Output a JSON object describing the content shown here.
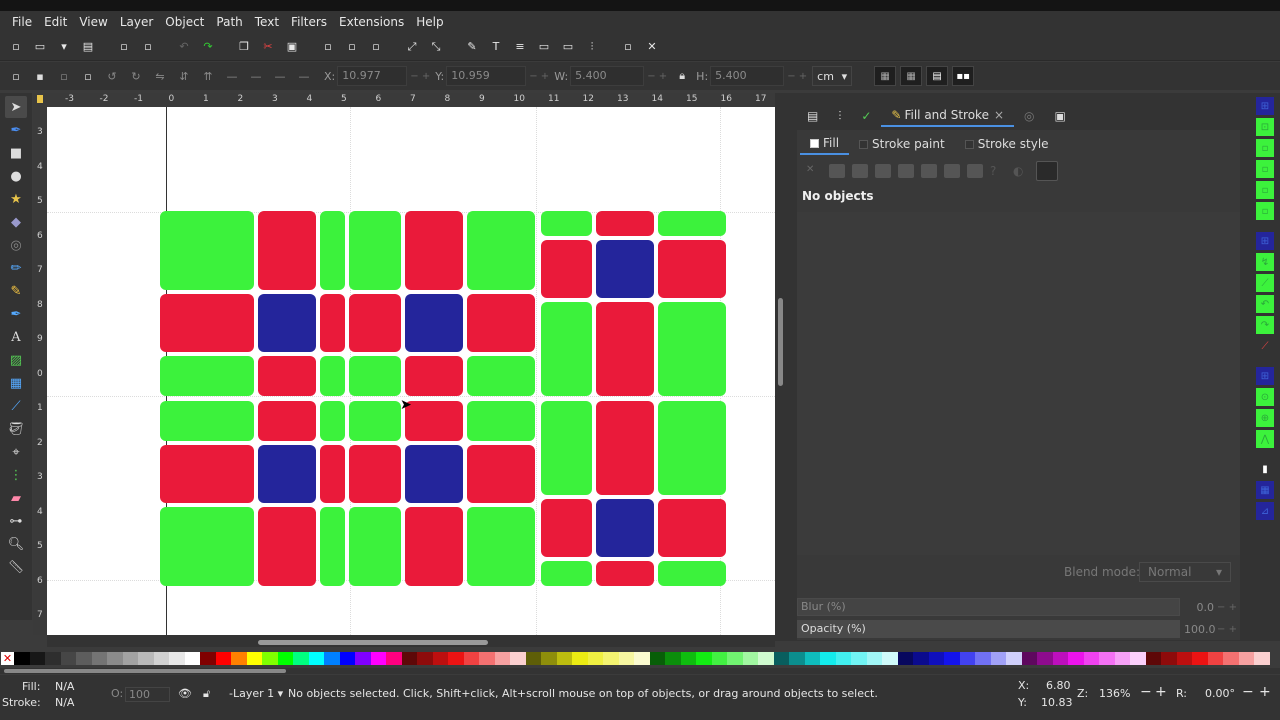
{
  "menu": [
    "File",
    "Edit",
    "View",
    "Layer",
    "Object",
    "Path",
    "Text",
    "Filters",
    "Extensions",
    "Help"
  ],
  "toolcontrols": {
    "x_label": "X:",
    "x_value": "10.977",
    "y_label": "Y:",
    "y_value": "10.959",
    "w_label": "W:",
    "w_value": "5.400",
    "h_label": "H:",
    "h_value": "5.400",
    "unit": "cm"
  },
  "ruler_top_labels": [
    "-3",
    "-2",
    "-1",
    "0",
    "1",
    "2",
    "3",
    "4",
    "5",
    "6",
    "7",
    "8",
    "9",
    "10",
    "11",
    "12",
    "13",
    "14",
    "15",
    "16",
    "17"
  ],
  "ruler_left_labels": [
    "3",
    "4",
    "5",
    "6",
    "7",
    "8",
    "9",
    "0",
    "1",
    "2",
    "3",
    "4",
    "5",
    "6",
    "7"
  ],
  "dock": {
    "tabs": [
      "",
      "",
      "",
      "Fill and Stroke",
      "",
      ""
    ],
    "active_tab": "Fill and Stroke",
    "close_glyph": "×",
    "fill_tabs": [
      "Fill",
      "Stroke paint",
      "Stroke style"
    ],
    "no_objects": "No objects",
    "blend_mode_label": "Blend mode:",
    "blend_mode_value": "Normal",
    "blur_label": "Blur (%)",
    "blur_value": "0.0",
    "opacity_label": "Opacity (%)",
    "opacity_value": "100.0"
  },
  "status": {
    "fill_label": "Fill:",
    "fill_value": "N/A",
    "stroke_label": "Stroke:",
    "stroke_value": "N/A",
    "o_label": "O:",
    "o_value": "100",
    "layer": "-Layer 1",
    "message": "No objects selected. Click, Shift+click, Alt+scroll mouse on top of objects, or drag around objects to select.",
    "x_label": "X:",
    "x_value": "6.80",
    "y_label": "Y:",
    "y_value": "10.83",
    "zoom_label": "Z:",
    "zoom_value": "136%",
    "rotate_label": "R:",
    "rotate_value": "0.00°"
  },
  "colors": {
    "green": "#3cf23c",
    "red": "#ea1a3a",
    "blue": "#24259b",
    "accent": "#4a90e2"
  }
}
